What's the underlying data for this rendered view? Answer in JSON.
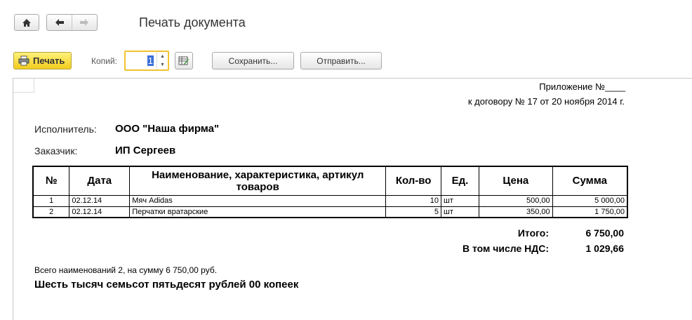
{
  "window": {
    "title": "Печать документа"
  },
  "nav": {
    "home_icon": "home-icon",
    "back_icon": "arrow-left-icon",
    "forward_icon": "arrow-right-icon"
  },
  "toolbar": {
    "print_label": "Печать",
    "copies_label": "Копий:",
    "copies_value": "1",
    "save_label": "Сохранить...",
    "send_label": "Отправить..."
  },
  "document": {
    "annex": "Приложение №____",
    "contract": "к договору № 17 от 20 ноября 2014 г.",
    "executor_label": "Исполнитель:",
    "executor_value": "ООО \"Наша фирма\"",
    "customer_label": "Заказчик:",
    "customer_value": "ИП Сергеев",
    "table": {
      "headers": {
        "num": "№",
        "date": "Дата",
        "name": "Наименование, характеристика, артикул товаров",
        "qty": "Кол-во",
        "unit": "Ед.",
        "price": "Цена",
        "sum": "Сумма"
      },
      "rows": [
        {
          "num": "1",
          "date": "02.12.14",
          "name": "Мяч Adidas",
          "qty": "10",
          "unit": "шт",
          "price": "500,00",
          "sum": "5 000,00"
        },
        {
          "num": "2",
          "date": "02.12.14",
          "name": "Перчатки вратарские",
          "qty": "5",
          "unit": "шт",
          "price": "350,00",
          "sum": "1 750,00"
        }
      ]
    },
    "total_label": "Итого:",
    "total_value": "6 750,00",
    "vat_label": "В том числе НДС:",
    "vat_value": "1 029,66",
    "summary_line": "Всего наименований 2, на сумму 6 750,00 руб.",
    "amount_words": "Шесть тысяч семьсот пятьдесят рублей 00 копеек"
  }
}
